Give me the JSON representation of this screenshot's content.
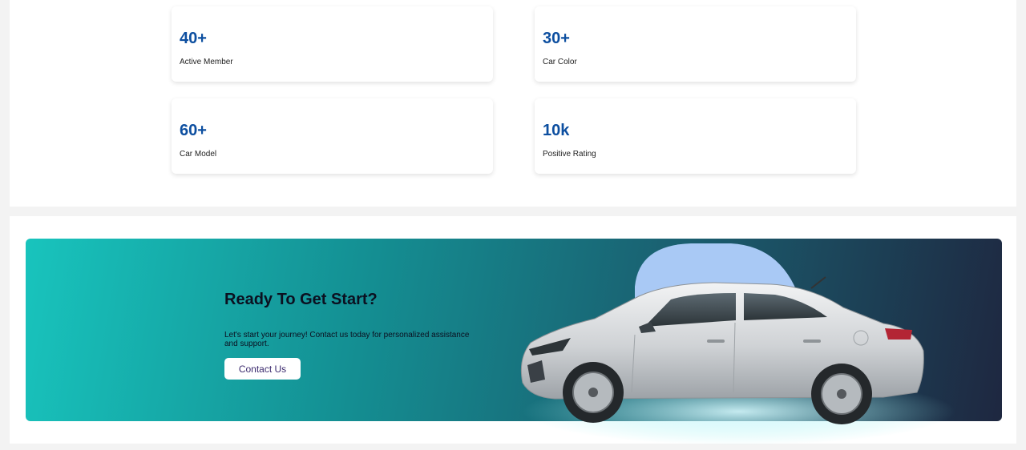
{
  "stats": [
    {
      "value": "40+",
      "label": "Active Member"
    },
    {
      "value": "30+",
      "label": "Car Color"
    },
    {
      "value": "60+",
      "label": "Car Model"
    },
    {
      "value": "10k",
      "label": "Positive Rating"
    }
  ],
  "cta": {
    "title": "Ready To Get Start?",
    "text": "Let's start your journey! Contact us today for personalized assistance and support.",
    "button_label": "Contact Us"
  },
  "colors": {
    "stat_value": "#0d4fa0",
    "banner_start": "#18c4bd",
    "banner_end": "#1e2740",
    "car_backdrop": "#a9c9f5",
    "car_body": "#d6d8db"
  },
  "icons": [
    "car-image"
  ]
}
